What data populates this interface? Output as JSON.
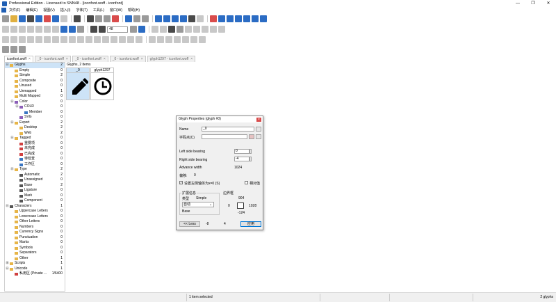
{
  "window": {
    "title": "Professional Edition - Licensed to SNN48 - [iconfont.woff - iconfont]"
  },
  "menu": [
    "文件(F)",
    "编辑(E)",
    "视图(V)",
    "插入(I)",
    "字体(T)",
    "工具(L)",
    "窗口(W)",
    "帮助(H)"
  ],
  "toolbar": {
    "zoom_value": "48"
  },
  "tabs": [
    {
      "label": "iconfont.woff",
      "active": true
    },
    {
      "label": "_0 - iconfont.woff",
      "active": false
    },
    {
      "label": "_0 - iconfont.woff",
      "active": false
    },
    {
      "label": "_0 - iconfont.woff",
      "active": false
    },
    {
      "label": "glyph1297 - iconfont.woff",
      "active": false
    }
  ],
  "tree": [
    {
      "label": "Glyphs",
      "count": "2",
      "indent": 0,
      "exp": "⊟",
      "icon": "folder",
      "sel": true
    },
    {
      "label": "Empty",
      "count": "0",
      "indent": 1,
      "exp": "",
      "icon": "folder"
    },
    {
      "label": "Simple",
      "count": "2",
      "indent": 1,
      "exp": "",
      "icon": "folder"
    },
    {
      "label": "Composite",
      "count": "0",
      "indent": 1,
      "exp": "",
      "icon": "folder"
    },
    {
      "label": "Unused",
      "count": "0",
      "indent": 1,
      "exp": "",
      "icon": "folder"
    },
    {
      "label": "Unmapped",
      "count": "1",
      "indent": 1,
      "exp": "",
      "icon": "folder"
    },
    {
      "label": "Multi Mapped",
      "count": "0",
      "indent": 1,
      "exp": "",
      "icon": "folder"
    },
    {
      "label": "Color",
      "count": "0",
      "indent": 1,
      "exp": "⊟",
      "icon": "purple"
    },
    {
      "label": "COLR",
      "count": "0",
      "indent": 2,
      "exp": "⊟",
      "icon": "purple"
    },
    {
      "label": "Member",
      "count": "0",
      "indent": 3,
      "exp": "",
      "icon": "blue"
    },
    {
      "label": "SVG",
      "count": "0",
      "indent": 2,
      "exp": "",
      "icon": "purple"
    },
    {
      "label": "Export",
      "count": "2",
      "indent": 1,
      "exp": "⊟",
      "icon": "folder"
    },
    {
      "label": "Desktop",
      "count": "2",
      "indent": 2,
      "exp": "",
      "icon": "folder"
    },
    {
      "label": "Web",
      "count": "2",
      "indent": 2,
      "exp": "",
      "icon": "folder"
    },
    {
      "label": "Tagged",
      "count": "0",
      "indent": 1,
      "exp": "⊟",
      "icon": "folder"
    },
    {
      "label": "重要项",
      "count": "0",
      "indent": 2,
      "exp": "",
      "icon": "red"
    },
    {
      "label": "未完成",
      "count": "0",
      "indent": 2,
      "exp": "",
      "icon": "red"
    },
    {
      "label": "已完成",
      "count": "0",
      "indent": 2,
      "exp": "",
      "icon": "red"
    },
    {
      "label": "待检查",
      "count": "0",
      "indent": 2,
      "exp": "",
      "icon": "blue"
    },
    {
      "label": "工作区",
      "count": "0",
      "indent": 2,
      "exp": "",
      "icon": "blue"
    },
    {
      "label": "Type",
      "count": "2",
      "indent": 1,
      "exp": "⊟",
      "icon": "folder"
    },
    {
      "label": "Automatic",
      "count": "2",
      "indent": 2,
      "exp": "",
      "icon": "dark"
    },
    {
      "label": "Unassigned",
      "count": "0",
      "indent": 2,
      "exp": "",
      "icon": "dark"
    },
    {
      "label": "Base",
      "count": "2",
      "indent": 2,
      "exp": "",
      "icon": "dark"
    },
    {
      "label": "Ligature",
      "count": "0",
      "indent": 2,
      "exp": "",
      "icon": "dark"
    },
    {
      "label": "Mark",
      "count": "0",
      "indent": 2,
      "exp": "",
      "icon": "dark"
    },
    {
      "label": "Component",
      "count": "0",
      "indent": 2,
      "exp": "",
      "icon": "dark"
    },
    {
      "label": "Characters",
      "count": "1",
      "indent": 0,
      "exp": "⊟",
      "icon": "dark"
    },
    {
      "label": "Uppercase Letters",
      "count": "0",
      "indent": 1,
      "exp": "",
      "icon": "folder"
    },
    {
      "label": "Lowercase Letters",
      "count": "0",
      "indent": 1,
      "exp": "",
      "icon": "folder"
    },
    {
      "label": "Other Letters",
      "count": "0",
      "indent": 1,
      "exp": "",
      "icon": "folder"
    },
    {
      "label": "Numbers",
      "count": "0",
      "indent": 1,
      "exp": "",
      "icon": "folder"
    },
    {
      "label": "Currency Signs",
      "count": "0",
      "indent": 1,
      "exp": "",
      "icon": "folder"
    },
    {
      "label": "Punctuation",
      "count": "0",
      "indent": 1,
      "exp": "",
      "icon": "folder"
    },
    {
      "label": "Marks",
      "count": "0",
      "indent": 1,
      "exp": "",
      "icon": "folder"
    },
    {
      "label": "Symbols",
      "count": "0",
      "indent": 1,
      "exp": "",
      "icon": "folder"
    },
    {
      "label": "Separators",
      "count": "0",
      "indent": 1,
      "exp": "",
      "icon": "folder"
    },
    {
      "label": "Other",
      "count": "1",
      "indent": 1,
      "exp": "",
      "icon": "folder"
    },
    {
      "label": "Scripts",
      "count": "1",
      "indent": 0,
      "exp": "⊞",
      "icon": "folder"
    },
    {
      "label": "Unicode",
      "count": "1",
      "indent": 0,
      "exp": "⊟",
      "icon": "folder"
    },
    {
      "label": "私用区 (Private ...",
      "count": "1/6400",
      "indent": 1,
      "exp": "",
      "icon": "red"
    }
  ],
  "glyphs": {
    "header": "Glyphs, 2 items",
    "cells": [
      {
        "name": "_0",
        "icon": "pencil-glyph",
        "selected": true
      },
      {
        "name": "glyph1297",
        "icon": "clock-glyph",
        "selected": false
      }
    ]
  },
  "dialog": {
    "title": "Glyph Properties (glyph #0)",
    "name_label": "Name",
    "name_value": "_0",
    "charcode_label": "字码点(C)",
    "charcode_value": "",
    "lsb_label": "Left side bearing",
    "lsb_value": "0",
    "rsb_label": "Right side bearing",
    "rsb_value": "-4",
    "advance_label": "Advance width",
    "advance_value": "1024",
    "offset_label": "偏移:",
    "offset_value": "0",
    "check1_label": "设置左侧轴体为x=0 (S)",
    "check1_checked": true,
    "check2_label": "相对值",
    "check2_checked": false,
    "ext_group_label": "扩展信息",
    "type_label": "类型",
    "type_value": "Simple",
    "select_value": "自动",
    "base_label": "Base",
    "bbox_label": "边界框",
    "bbox_top": "904",
    "bbox_left": "0",
    "bbox_right": "1028",
    "bbox_bottom": "-124",
    "less_button": "<< Less",
    "footer_left": "-8",
    "footer_mid": "4",
    "apply_button": "应用"
  },
  "status": {
    "selected": "1 item selected",
    "total": "2 glyphs"
  }
}
